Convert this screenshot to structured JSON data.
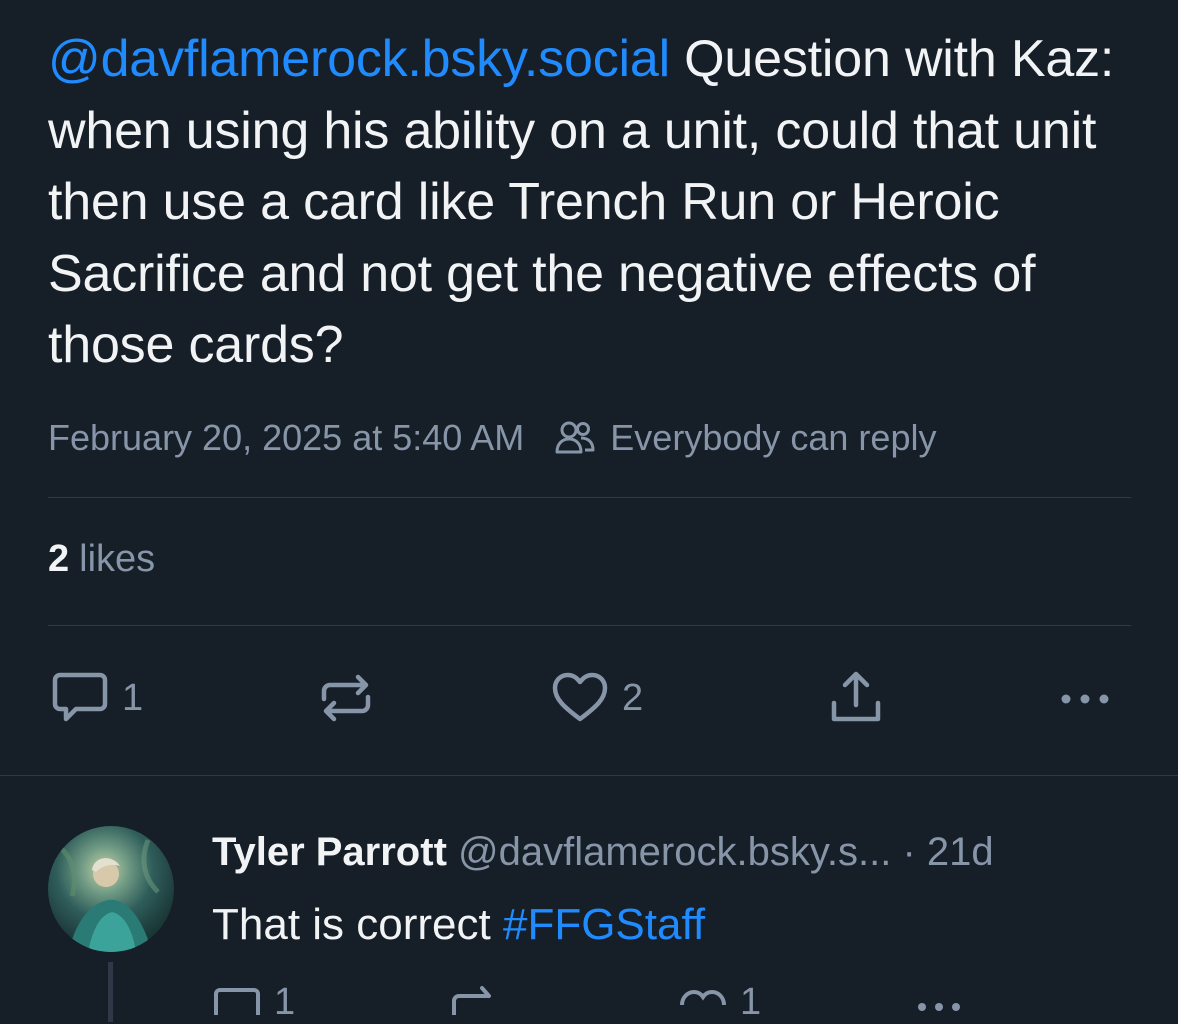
{
  "post": {
    "mention": "@davflamerock.bsky.social",
    "text": " Question with Kaz: when using his ability on a unit, could that unit then use a card like Trench Run or Heroic Sacrifice and not get the negative effects of those cards?",
    "timestamp": "February 20, 2025 at 5:40 AM",
    "reply_setting": "Everybody can reply",
    "likes_count": "2",
    "likes_label": "likes",
    "actions": {
      "reply_count": "1",
      "like_count": "2"
    }
  },
  "reply": {
    "author_name": "Tyler Parrott",
    "author_handle": "@davflamerock.bsky.s...",
    "separator": "·",
    "age": "21d",
    "text": "That is correct ",
    "hashtag": "#FFGStaff",
    "reply_count": "1",
    "like_count": "1"
  },
  "colors": {
    "background": "#161e27",
    "accent": "#208bfe",
    "muted": "#8795a8",
    "text": "#f1f3f5"
  },
  "icons": [
    "people-icon",
    "comment-icon",
    "repost-icon",
    "heart-icon",
    "share-icon",
    "more-icon"
  ]
}
